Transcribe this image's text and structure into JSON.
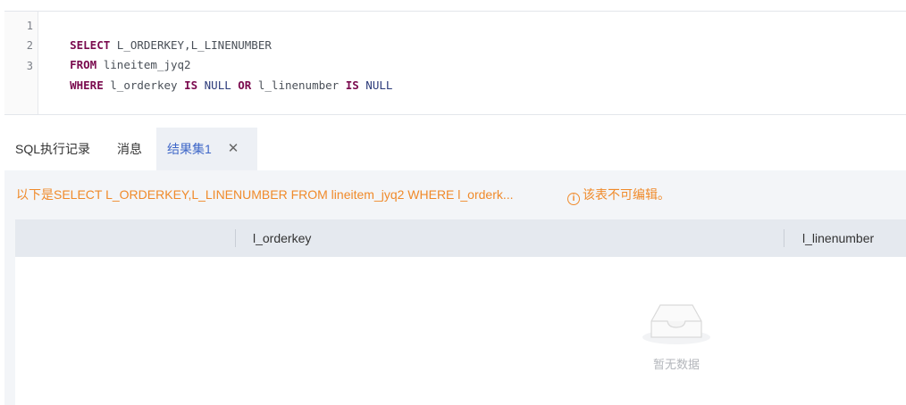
{
  "editor": {
    "line_numbers": [
      "1",
      "2",
      "3"
    ],
    "lines": [
      {
        "kw1": "SELECT",
        "rest": " L_ORDERKEY,L_LINENUMBER"
      },
      {
        "kw1": "FROM",
        "rest": " lineitem_jyq2"
      },
      {
        "kw1": "WHERE",
        "p1": " l_orderkey ",
        "kw2": "IS",
        "n1": " NULL ",
        "kw3": "OR",
        "p2": " l_linenumber ",
        "kw4": "IS",
        "n2": " NULL"
      }
    ]
  },
  "tabs": {
    "history": "SQL执行记录",
    "messages": "消息",
    "result": "结果集1",
    "close_glyph": "✕"
  },
  "result": {
    "info_text": "以下是SELECT L_ORDERKEY,L_LINENUMBER FROM lineitem_jyq2 WHERE l_orderk...",
    "warn_icon": "i",
    "warn_text": "该表不可编辑。",
    "columns": [
      "l_orderkey",
      "l_linenumber"
    ],
    "empty_text": "暂无数据"
  },
  "colors": {
    "accent": "#3f67c8",
    "warning": "#f08a2a",
    "keyword": "#7a0a4e"
  }
}
